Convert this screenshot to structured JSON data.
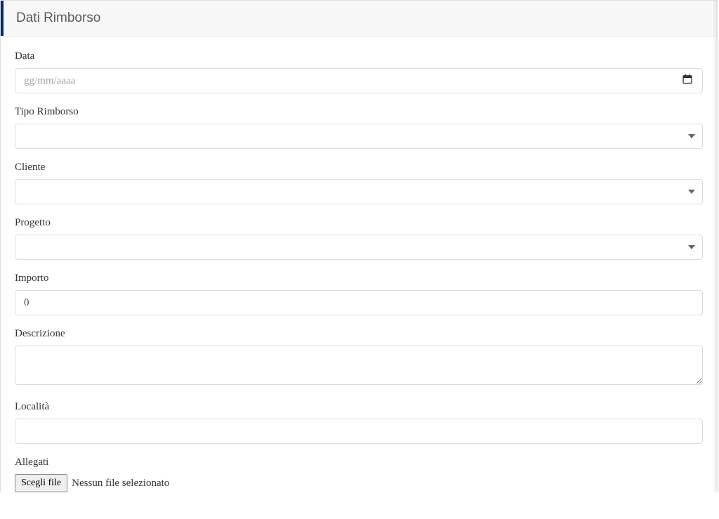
{
  "panel": {
    "title": "Dati Rimborso"
  },
  "form": {
    "date_label": "Data",
    "date_placeholder": "gg/mm/aaaa",
    "date_value": "",
    "type_label": "Tipo Rimborso",
    "type_value": "",
    "client_label": "Cliente",
    "client_value": "",
    "project_label": "Progetto",
    "project_value": "",
    "amount_label": "Importo",
    "amount_value": "0",
    "description_label": "Descrizione",
    "description_value": "",
    "location_label": "Località",
    "location_value": "",
    "attachments_label": "Allegati",
    "file_button_label": "Scegli file",
    "file_status": "Nessun file selezionato"
  }
}
